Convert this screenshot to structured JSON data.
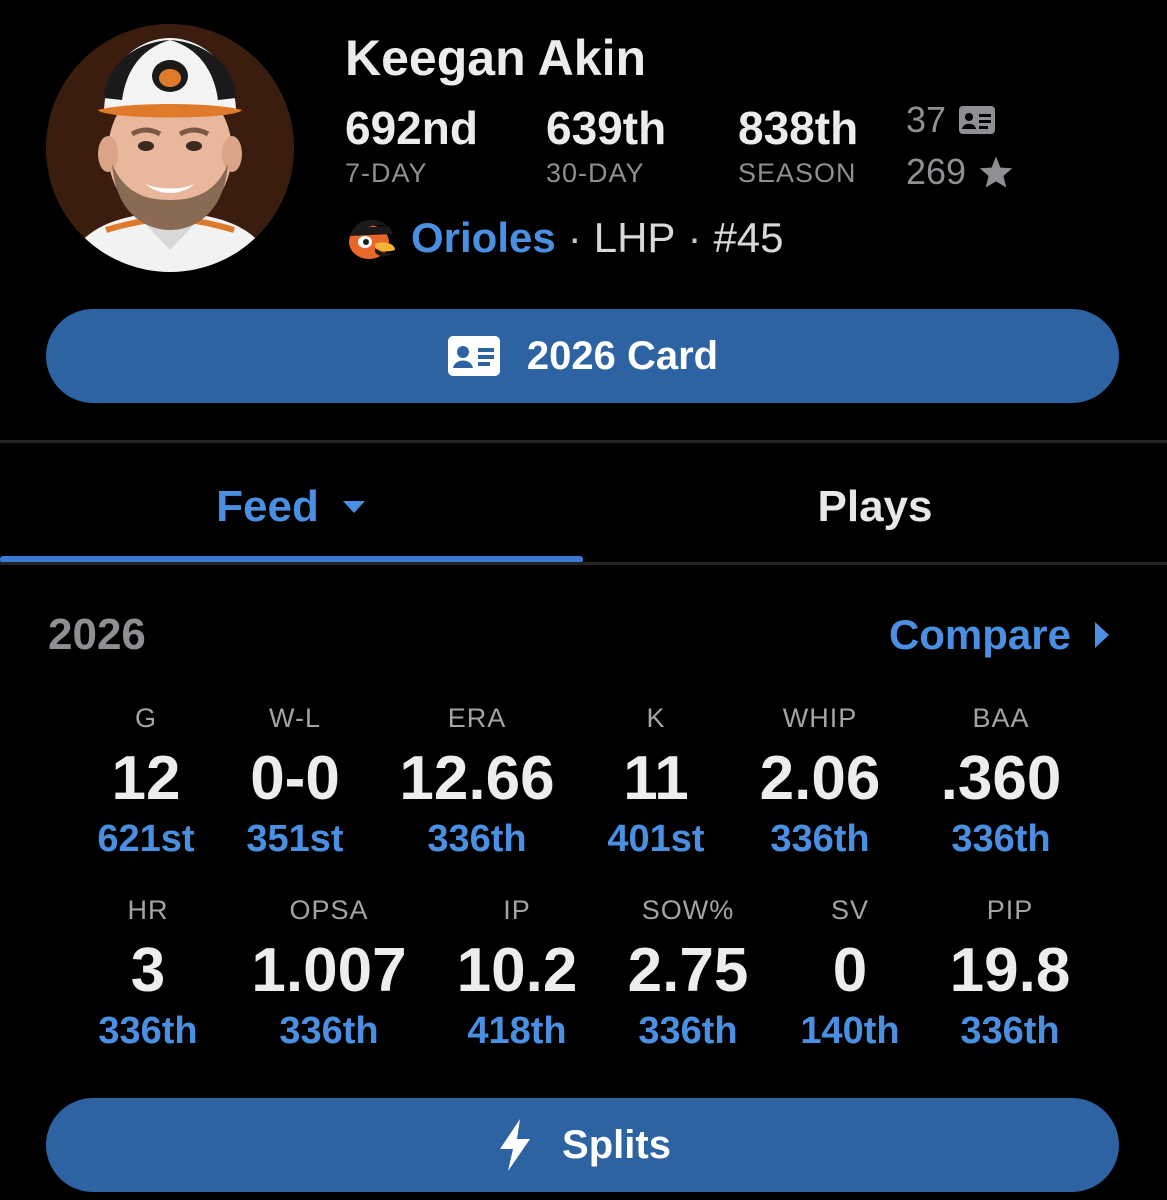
{
  "player": {
    "name": "Keegan Akin",
    "avatar_alt": "Keegan Akin headshot"
  },
  "rankings": [
    {
      "value": "692nd",
      "label": "7-DAY"
    },
    {
      "value": "639th",
      "label": "30-DAY"
    },
    {
      "value": "838th",
      "label": "SEASON"
    }
  ],
  "side_counts": {
    "cards": "37",
    "cards_icon": "id-card-icon",
    "stars": "269",
    "stars_icon": "star-icon"
  },
  "team": {
    "name": "Orioles",
    "logo_icon": "orioles-bird-icon",
    "sep1": "·",
    "position": "LHP",
    "sep2": "·",
    "number": "#45"
  },
  "card_button": {
    "label": "2026 Card",
    "icon": "id-card-icon"
  },
  "tabs": [
    {
      "label": "Feed",
      "active": true,
      "icon": "caret-down-icon"
    },
    {
      "label": "Plays",
      "active": false
    }
  ],
  "stats": {
    "season": "2026",
    "compare_label": "Compare",
    "compare_icon": "caret-right-icon",
    "row1": [
      {
        "label": "G",
        "value": "12",
        "rank": "621st"
      },
      {
        "label": "W-L",
        "value": "0-0",
        "rank": "351st"
      },
      {
        "label": "ERA",
        "value": "12.66",
        "rank": "336th"
      },
      {
        "label": "K",
        "value": "11",
        "rank": "401st"
      },
      {
        "label": "WHIP",
        "value": "2.06",
        "rank": "336th"
      },
      {
        "label": "BAA",
        "value": ".360",
        "rank": "336th"
      }
    ],
    "row2": [
      {
        "label": "HR",
        "value": "3",
        "rank": "336th"
      },
      {
        "label": "OPSA",
        "value": "1.007",
        "rank": "336th"
      },
      {
        "label": "IP",
        "value": "10.2",
        "rank": "418th"
      },
      {
        "label": "SOW%",
        "value": "2.75",
        "rank": "336th"
      },
      {
        "label": "SV",
        "value": "0",
        "rank": "140th"
      },
      {
        "label": "PIP",
        "value": "19.8",
        "rank": "336th"
      }
    ]
  },
  "splits_button": {
    "label": "Splits",
    "icon": "lightning-bolt-icon"
  },
  "colors": {
    "background": "#000000",
    "accent": "#4a90e2",
    "button": "#2d62a3",
    "muted": "#8e8e93"
  }
}
